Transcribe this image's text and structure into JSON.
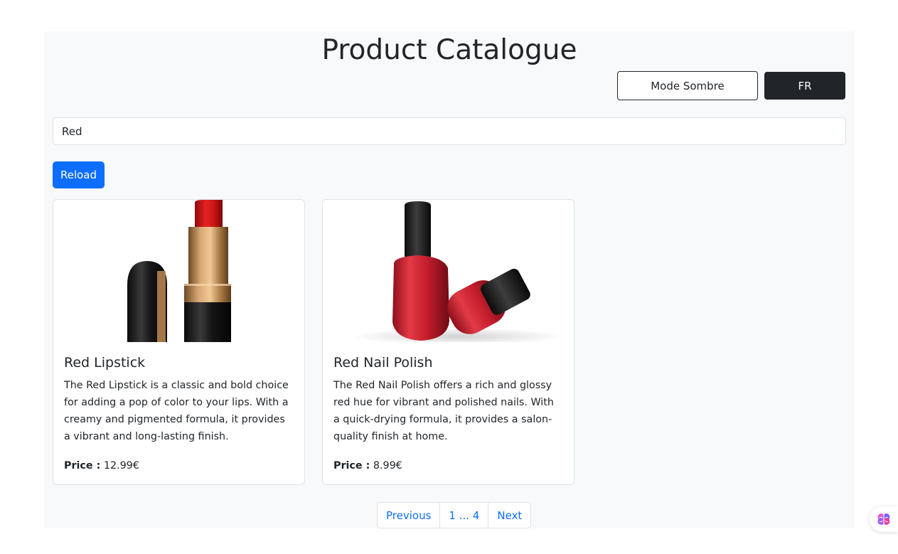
{
  "header": {
    "title": "Product Catalogue",
    "mode_button": "Mode Sombre",
    "lang_button": "FR"
  },
  "search": {
    "value": "Red"
  },
  "reload_label": "Reload",
  "products": [
    {
      "name": "Red Lipstick",
      "description": "The Red Lipstick is a classic and bold choice for adding a pop of color to your lips. With a creamy and pigmented formula, it provides a vibrant and long-lasting finish.",
      "price_label": "Price :",
      "price": "12.99€",
      "image_icon": "lipstick-image"
    },
    {
      "name": "Red Nail Polish",
      "description": "The Red Nail Polish offers a rich and glossy red hue for vibrant and polished nails. With a quick-drying formula, it provides a salon-quality finish at home.",
      "price_label": "Price :",
      "price": "8.99€",
      "image_icon": "nail-polish-image"
    }
  ],
  "pagination": {
    "previous": "Previous",
    "pages": "1 ... 4",
    "next": "Next"
  },
  "colors": {
    "primary": "#0d6efd",
    "dark": "#212529",
    "background": "#f8f9fa",
    "border": "#dee2e6"
  },
  "floating_icon": "brain-icon"
}
